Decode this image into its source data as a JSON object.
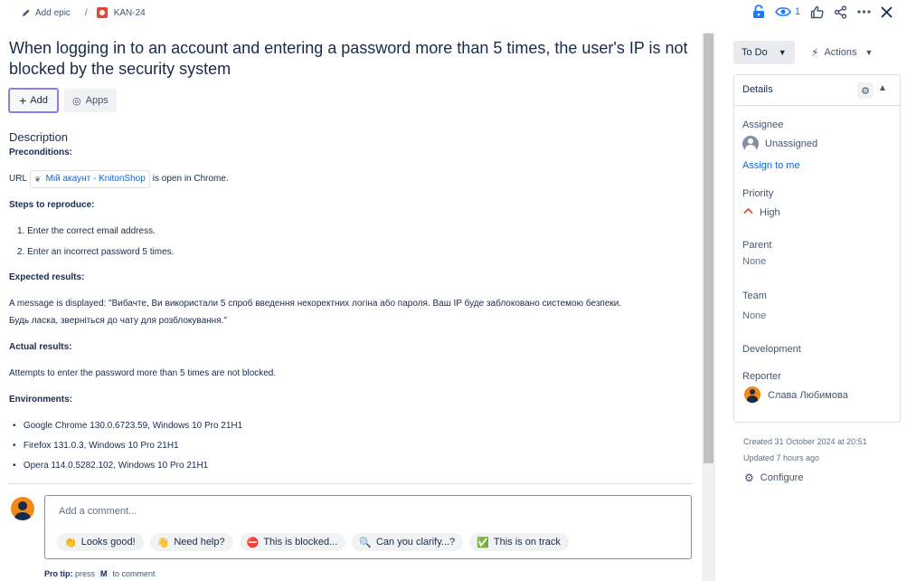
{
  "breadcrumb": {
    "epic_label": "Add epic",
    "separator": "/",
    "issue_key": "KAN-24"
  },
  "toolbar": {
    "watch_count": "1"
  },
  "issue": {
    "title": "When logging in to an account and entering a password more than 5 times, the user's IP is not blocked by the security system",
    "add_label": "Add",
    "apps_label": "Apps"
  },
  "description": {
    "heading": "Description",
    "preconditions_h": "Preconditions:",
    "url_prefix": "URL",
    "link_text": "Мій акаунт - KnitonShop",
    "url_suffix": "is open in Chrome.",
    "steps_h": "Steps to reproduce:",
    "steps": [
      "Enter the correct email address.",
      "Enter an incorrect password 5 times."
    ],
    "expected_h": "Expected results:",
    "expected_l1": "A message is displayed: \"Вибачте, Ви використали 5 спроб введення некоректних логіна або пароля. Ваш IP буде заблоковано системою безпеки.",
    "expected_l2": "Будь ласка, зверніться до чату для розблокування.\"",
    "actual_h": "Actual results:",
    "actual": "Attempts to enter the password more than 5 times are not blocked.",
    "env_h": "Environments:",
    "envs": [
      "Google Chrome 130.0.6723.59, Windows 10 Pro 21H1",
      "Firefox 131.0.3, Windows 10 Pro 21H1",
      "Opera 114.0.5282.102, Windows 10 Pro 21H1"
    ]
  },
  "comment": {
    "placeholder": "Add a comment...",
    "chips": [
      {
        "emoji": "👏",
        "label": "Looks good!"
      },
      {
        "emoji": "👋",
        "label": "Need help?"
      },
      {
        "emoji": "⛔",
        "label": "This is blocked..."
      },
      {
        "emoji": "🔍",
        "label": "Can you clarify...?"
      },
      {
        "emoji": "✅",
        "label": "This is on track"
      }
    ],
    "protip_b": "Pro tip:",
    "protip_1": "press",
    "protip_key": "M",
    "protip_2": "to comment"
  },
  "sidebar": {
    "status": "To Do",
    "actions": "Actions",
    "details_label": "Details",
    "assignee_l": "Assignee",
    "assignee_v": "Unassigned",
    "assign_me": "Assign to me",
    "priority_l": "Priority",
    "priority_v": "High",
    "parent_l": "Parent",
    "parent_v": "None",
    "team_l": "Team",
    "team_v": "None",
    "development_l": "Development",
    "reporter_l": "Reporter",
    "reporter_v": "Слава Любимова",
    "created": "Created 31 October 2024 at 20:51",
    "updated": "Updated 7 hours ago",
    "configure": "Configure"
  },
  "colors": {
    "priority_high": "#e2483d",
    "link": "#0c66e4",
    "avatar_orange": "#f38a16",
    "add_border": "#8f7ee7"
  }
}
